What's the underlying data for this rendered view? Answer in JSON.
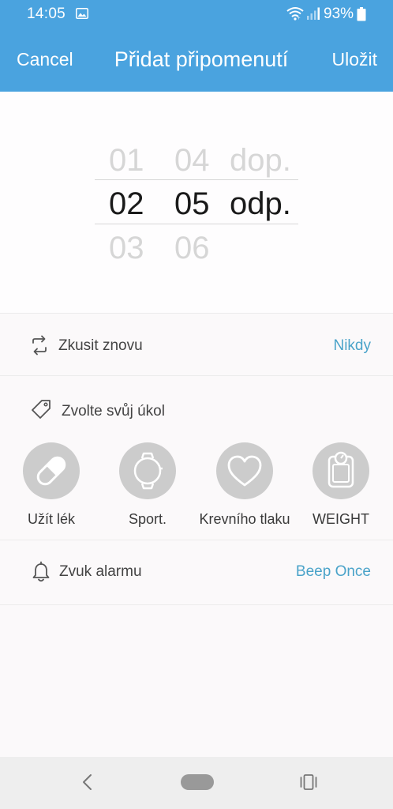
{
  "status_bar": {
    "time": "14:05",
    "battery": "93%"
  },
  "app_bar": {
    "cancel_label": "Cancel",
    "title": "Přidat připomenutí",
    "save_label": "Uložit"
  },
  "time_picker": {
    "hours": [
      "01",
      "02",
      "03"
    ],
    "minutes": [
      "04",
      "05",
      "06"
    ],
    "periods": [
      "dop.",
      "odp."
    ],
    "selected": {
      "hour": "02",
      "minute": "05",
      "period": "odp."
    }
  },
  "repeat": {
    "label": "Zkusit znovu",
    "value": "Nikdy"
  },
  "task": {
    "label": "Zvolte svůj úkol",
    "options": [
      {
        "label": "Užít lék",
        "icon": "pill-icon"
      },
      {
        "label": "Sport.",
        "icon": "watch-icon"
      },
      {
        "label": "Krevního tlaku",
        "icon": "heart-icon"
      },
      {
        "label": "WEIGHT",
        "icon": "scale-icon"
      }
    ]
  },
  "alarm": {
    "label": "Zvuk alarmu",
    "value": "Beep Once"
  },
  "colors": {
    "primary": "#4aa3df",
    "accent_text": "#4aa3c9",
    "icon_circle": "#cccccc"
  }
}
